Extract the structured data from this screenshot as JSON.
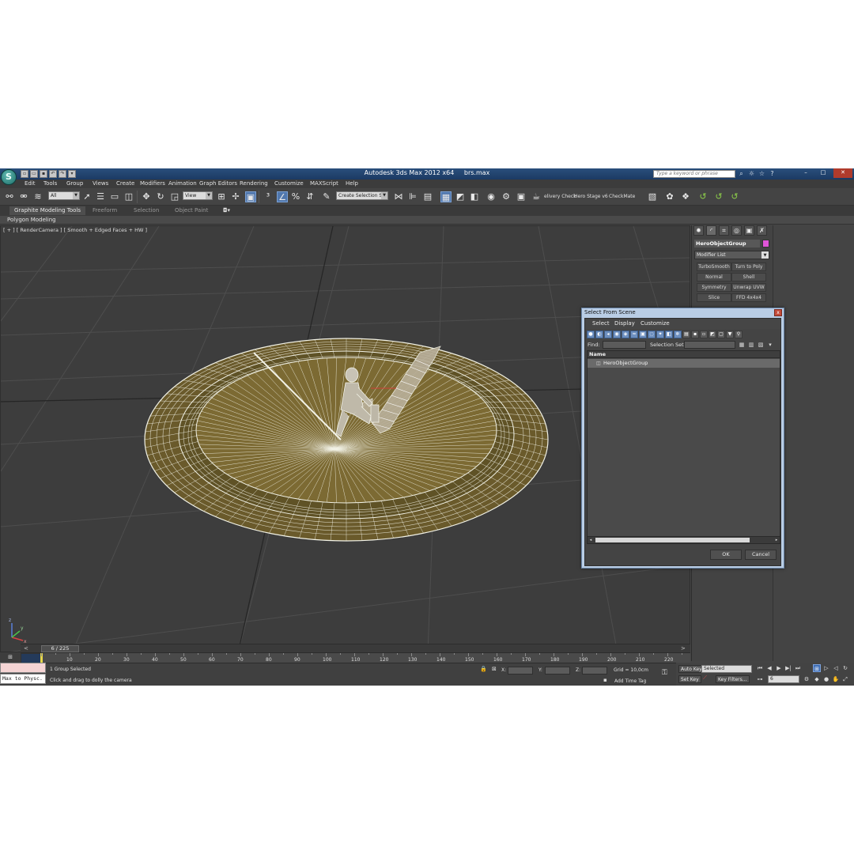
{
  "title_bar": {
    "app_name": "Autodesk 3ds Max  2012 x64",
    "file_name": "brs.max",
    "search_placeholder": "Type a keyword or phrase"
  },
  "menu": [
    "Edit",
    "Tools",
    "Group",
    "Views",
    "Create",
    "Modifiers",
    "Animation",
    "Graph Editors",
    "Rendering",
    "Customize",
    "MAXScript",
    "Help"
  ],
  "toolbar": {
    "selection_filter": "All",
    "reference_coord": "View",
    "named_selection": "Create Selection Se",
    "script_buttons": [
      "elivery Check",
      "Hero Stage v6",
      "CheckMate"
    ]
  },
  "ribbon": {
    "tabs": [
      "Graphite Modeling Tools",
      "Freeform",
      "Selection",
      "Object Paint"
    ],
    "sub_label": "Polygon Modeling"
  },
  "viewport": {
    "label": "[ + ] [ RenderCamera ] [ Smooth + Edged Faces + HW ]",
    "axis_labels": [
      "z",
      "y",
      "x"
    ]
  },
  "command_panel": {
    "object_name": "HeroObjectGroup",
    "object_color": "#e055d8",
    "modifier_list_label": "Modifier List",
    "modifier_buttons": [
      "TurboSmooth",
      "Turn to Poly",
      "Normal",
      "Shell",
      "Symmetry",
      "Unwrap UVW",
      "Slice",
      "FFD 4x4x4"
    ]
  },
  "select_dialog": {
    "title": "Select From Scene",
    "close_label": "x",
    "menu": [
      "Select",
      "Display",
      "Customize"
    ],
    "find_label": "Find:",
    "selection_set_label": "Selection Set:",
    "column_header": "Name",
    "rows": [
      "HeroObjectGroup"
    ],
    "ok_label": "OK",
    "cancel_label": "Cancel"
  },
  "timeline": {
    "frame_display": "6 / 225",
    "current_frame": 6,
    "total_frames": 225,
    "tick_labels": [
      "10",
      "20",
      "30",
      "40",
      "50",
      "60",
      "70",
      "80",
      "90",
      "100",
      "110",
      "120",
      "130",
      "140",
      "150",
      "160",
      "170",
      "180",
      "190",
      "200",
      "210",
      "220"
    ]
  },
  "status_bar": {
    "maxscript_text": "Max to Physc.",
    "selection_status": "1 Group Selected",
    "prompt": "Click and drag to dolly the camera",
    "x_label": "X:",
    "y_label": "Y:",
    "z_label": "Z:",
    "grid": "Grid = 10,0cm",
    "add_time_tag": "Add Time Tag"
  },
  "anim_controls": {
    "auto_key": "Auto Key",
    "set_key": "Set Key",
    "key_mode": "Selected",
    "key_filters": "Key Filters...",
    "frame_field": "6"
  },
  "colors": {
    "accent_blue": "#5077ad",
    "title_bar": "#1b3a63",
    "viewport_bg": "#3d3d3d",
    "model_fill": "#6e5e2c",
    "wire": "#f2f2e6"
  }
}
